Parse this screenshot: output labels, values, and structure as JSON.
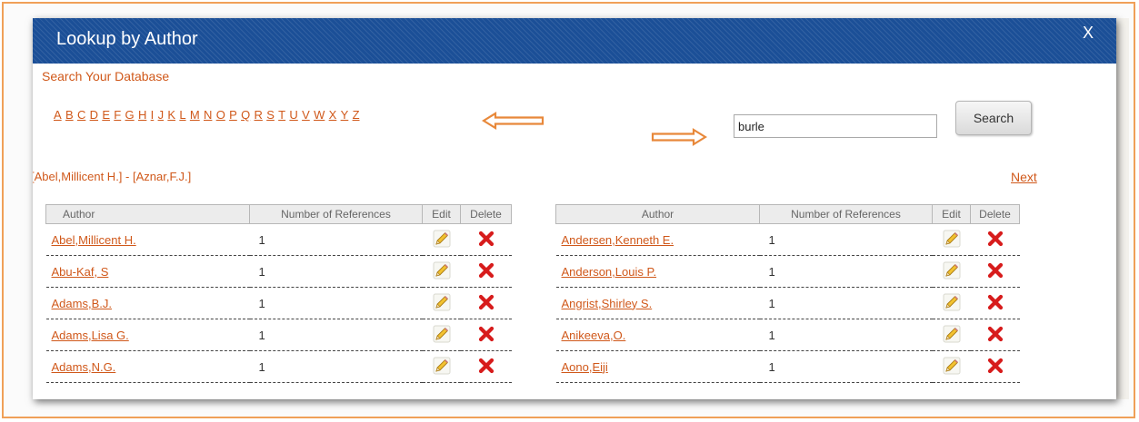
{
  "dialog": {
    "title": "Lookup by Author",
    "close_label": "X",
    "heading": "Search Your Database",
    "letters": [
      "A",
      "B",
      "C",
      "D",
      "E",
      "F",
      "G",
      "H",
      "I",
      "J",
      "K",
      "L",
      "M",
      "N",
      "O",
      "P",
      "Q",
      "R",
      "S",
      "T",
      "U",
      "V",
      "W",
      "X",
      "Y",
      "Z"
    ]
  },
  "search": {
    "value": "burle",
    "button_label": "Search"
  },
  "range": {
    "label": "[Abel,Millicent H.] - [Aznar,F.J.]",
    "next_label": "Next"
  },
  "table": {
    "headers": {
      "author": "Author",
      "count": "Number of References",
      "edit": "Edit",
      "delete": "Delete"
    },
    "left_rows": [
      {
        "author": "Abel,Millicent H.",
        "count": "1"
      },
      {
        "author": "Abu-Kaf, S",
        "count": "1"
      },
      {
        "author": "Adams,B.J.",
        "count": "1"
      },
      {
        "author": "Adams,Lisa G.",
        "count": "1"
      },
      {
        "author": "Adams,N.G.",
        "count": "1"
      }
    ],
    "right_rows": [
      {
        "author": "Andersen,Kenneth E.",
        "count": "1"
      },
      {
        "author": "Anderson,Louis P.",
        "count": "1"
      },
      {
        "author": "Angrist,Shirley S.",
        "count": "1"
      },
      {
        "author": "Anikeeva,O.",
        "count": "1"
      },
      {
        "author": "Aono,Eiji",
        "count": "1"
      }
    ]
  },
  "icons": {
    "edit": "pencil-icon",
    "delete": "red-x-icon",
    "annotations": "orange-hollow-arrow-icon"
  },
  "colors": {
    "title_bar": "#1b4f97",
    "link": "#d0581a",
    "frame": "#f0a058",
    "arrow": "#e8883a",
    "delete": "#d71c1c"
  }
}
